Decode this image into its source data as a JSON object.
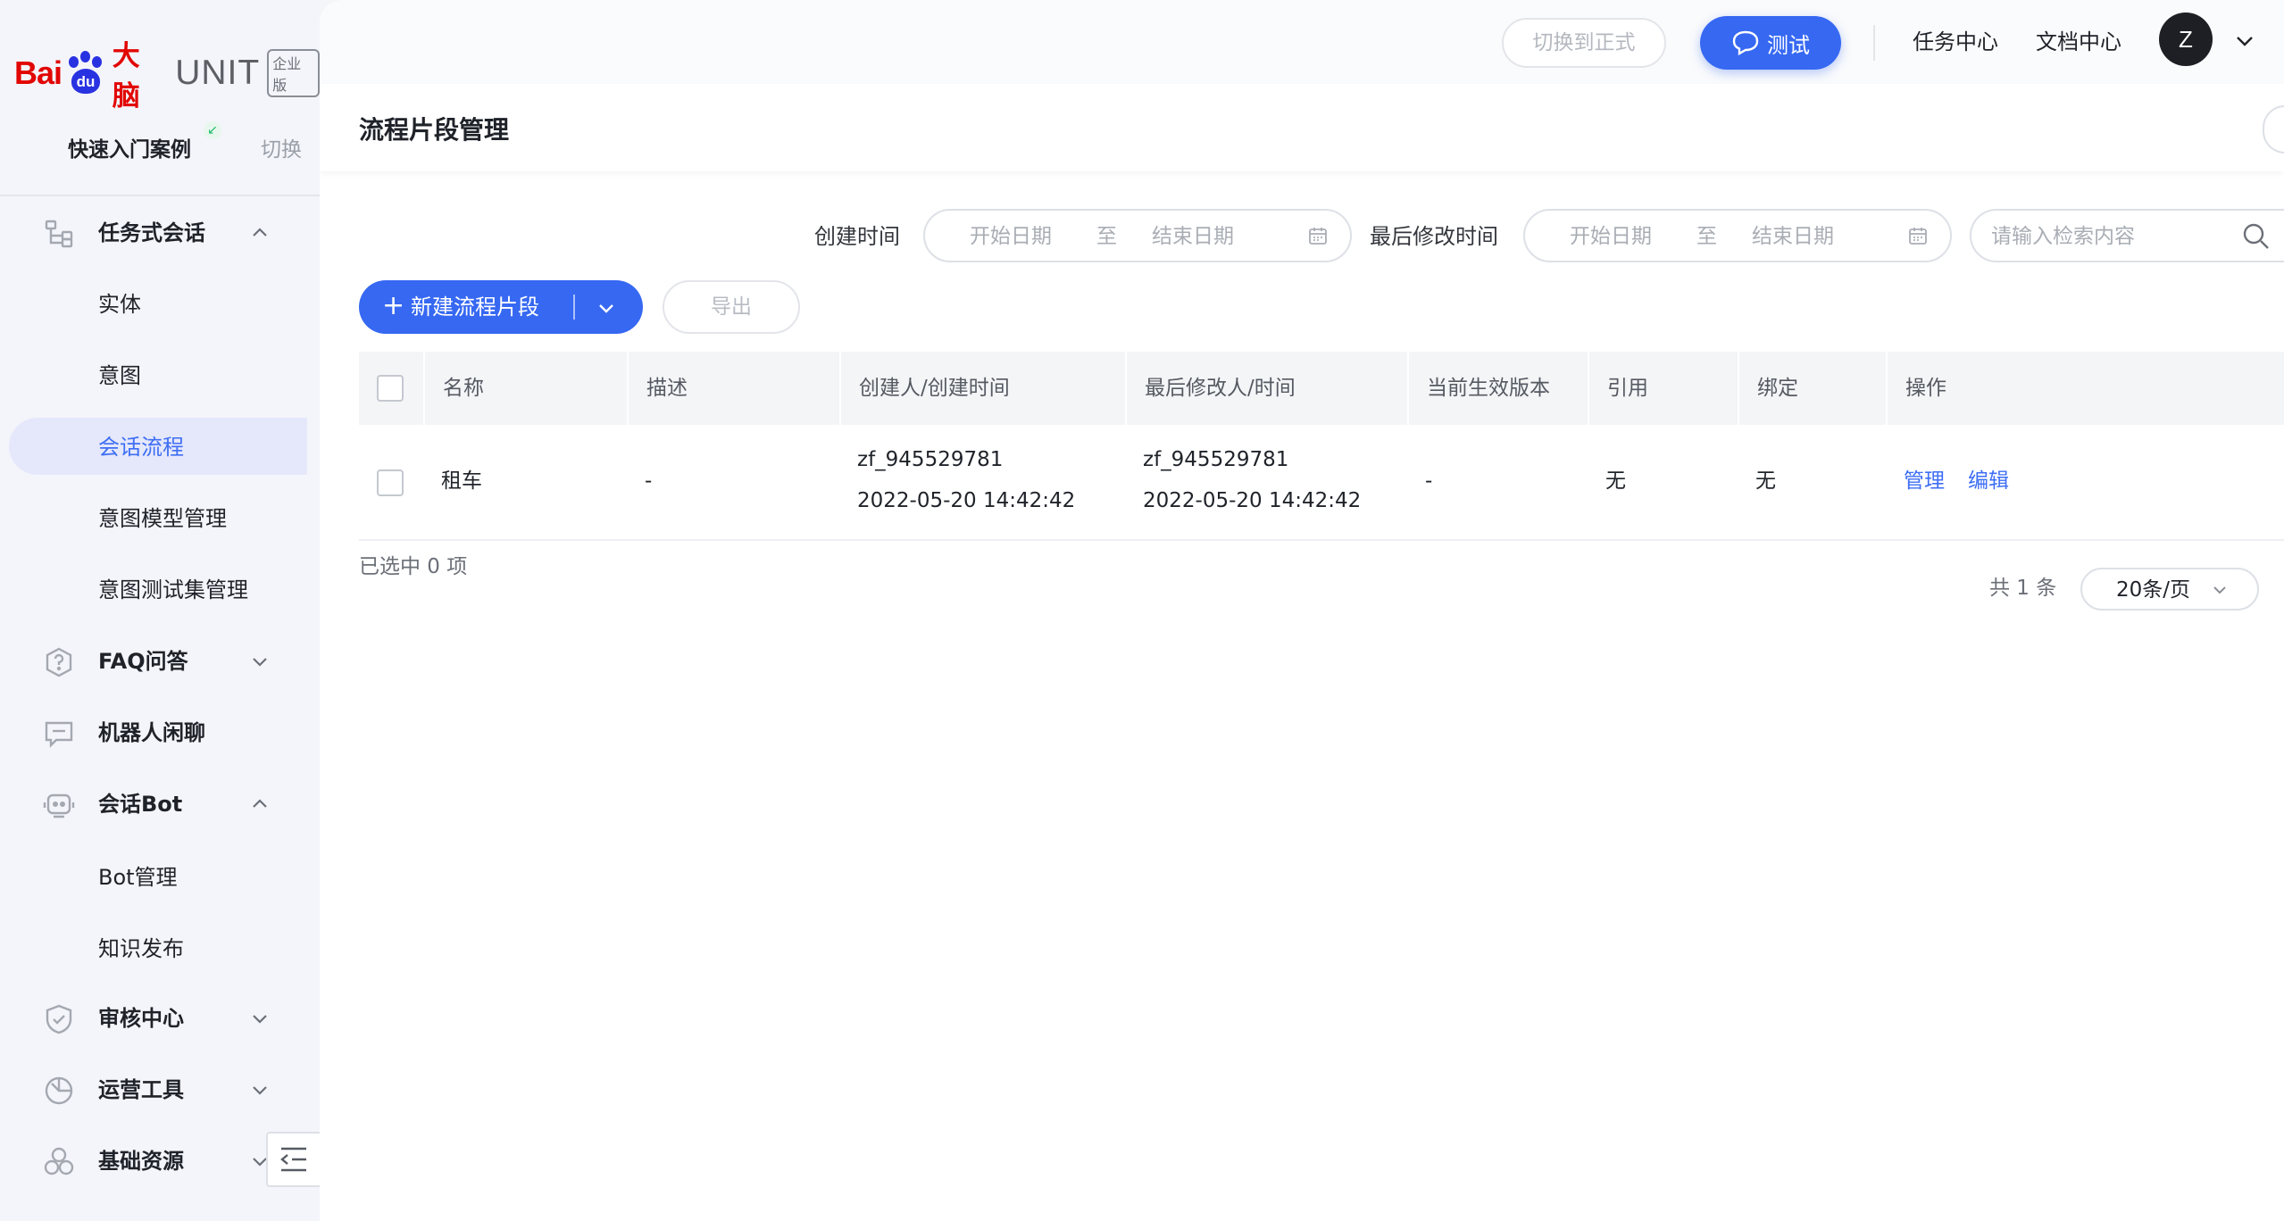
{
  "brand": {
    "bai": "Bai",
    "du": "du",
    "dn": "大脑",
    "unit": "UNIT",
    "edition": "企业版"
  },
  "workspace": {
    "title": "快速入门案例",
    "switch_label": "切换"
  },
  "sidebar": {
    "task_dialog": {
      "label": "任务式会话",
      "icon": "hierarchy-icon"
    },
    "task_sub": [
      {
        "label": "实体"
      },
      {
        "label": "意图"
      },
      {
        "label": "会话流程",
        "active": true
      },
      {
        "label": "意图模型管理"
      },
      {
        "label": "意图测试集管理"
      }
    ],
    "faq": {
      "label": "FAQ问答",
      "icon": "question-icon"
    },
    "chitchat": {
      "label": "机器人闲聊",
      "icon": "chat-icon"
    },
    "bot": {
      "label": "会话Bot",
      "icon": "robot-icon"
    },
    "bot_sub": [
      {
        "label": "Bot管理"
      },
      {
        "label": "知识发布"
      }
    ],
    "review": {
      "label": "审核中心",
      "icon": "shield-icon"
    },
    "ops": {
      "label": "运营工具",
      "icon": "gauge-icon"
    },
    "resources": {
      "label": "基础资源",
      "icon": "cluster-icon"
    }
  },
  "topbar": {
    "switch_formal": "切换到正式",
    "test": "测试",
    "task_center": "任务中心",
    "doc_center": "文档中心",
    "avatar": "Z"
  },
  "page": {
    "title": "流程片段管理"
  },
  "filters": {
    "created_label": "创建时间",
    "modified_label": "最后修改时间",
    "start_placeholder": "开始日期",
    "to": "至",
    "end_placeholder": "结束日期",
    "search_placeholder": "请输入检索内容"
  },
  "actions": {
    "new": "新建流程片段",
    "export": "导出"
  },
  "table": {
    "columns": [
      "名称",
      "描述",
      "创建人/创建时间",
      "最后修改人/时间",
      "当前生效版本",
      "引用",
      "绑定",
      "操作"
    ],
    "rows": [
      {
        "name": "租车",
        "desc": "-",
        "creator": "zf_945529781",
        "created_at": "2022-05-20 14:42:42",
        "modifier": "zf_945529781",
        "modified_at": "2022-05-20 14:42:42",
        "version": "-",
        "ref": "无",
        "bind": "无",
        "op_manage": "管理",
        "op_edit": "编辑"
      }
    ]
  },
  "footer": {
    "selected": "已选中 0 项",
    "total": "共 1 条",
    "page_size": "20条/页"
  },
  "colors": {
    "primary": "#3668f2",
    "link": "#3e6ef4",
    "brand_red": "#e10601",
    "brand_blue": "#2932e1"
  }
}
